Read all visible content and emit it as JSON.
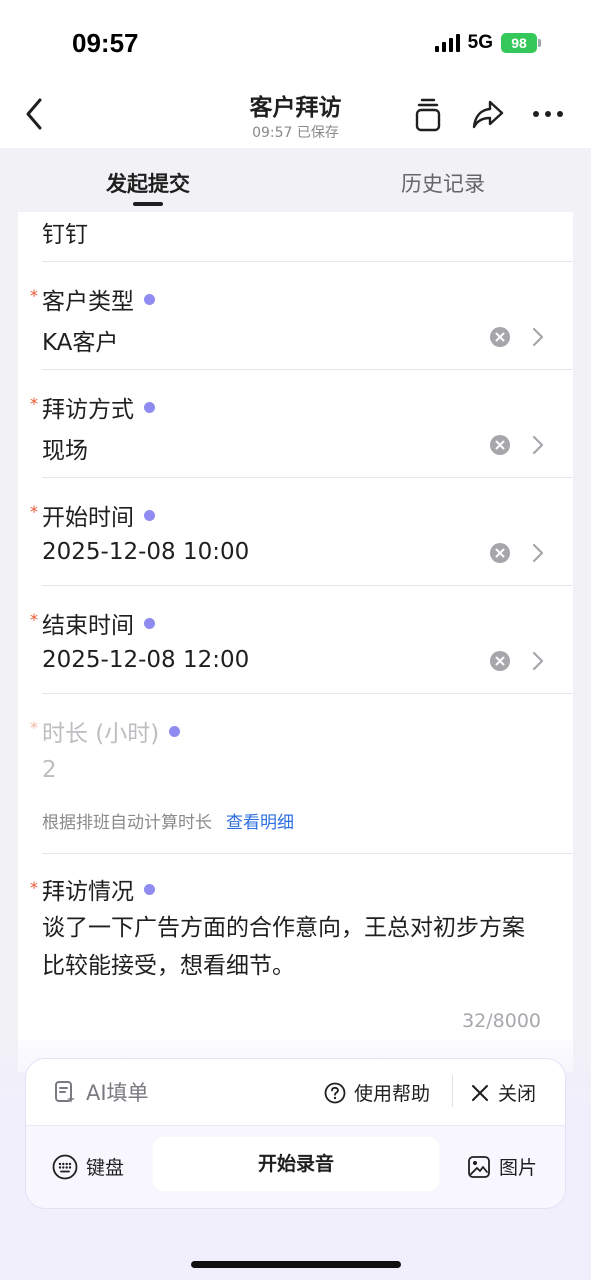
{
  "status": {
    "time": "09:57",
    "network": "5G",
    "battery": "98"
  },
  "nav": {
    "title": "客户拜访",
    "subtitle": "09:57 已保存",
    "icons": [
      "back-icon",
      "copy-icon",
      "share-icon",
      "more-icon"
    ]
  },
  "tabs": [
    {
      "label": "发起提交",
      "active": true
    },
    {
      "label": "历史记录",
      "active": false
    }
  ],
  "form": {
    "top_value": "钉钉",
    "customer_type": {
      "label": "客户类型",
      "value": "KA客户"
    },
    "visit_method": {
      "label": "拜访方式",
      "value": "现场"
    },
    "start_time": {
      "label": "开始时间",
      "value": "2025-12-08 10:00"
    },
    "end_time": {
      "label": "结束时间",
      "value": "2025-12-08 12:00"
    },
    "duration": {
      "label": "时长 (小时)",
      "value": "2",
      "hint": "根据排班自动计算时长",
      "hint_link": "查看明细"
    },
    "visit_notes": {
      "label": "拜访情况",
      "value": "谈了一下广告方面的合作意向，王总对初步方案比较能接受，想看细节。",
      "counter": "32/8000"
    },
    "required_mark": "*"
  },
  "ai_panel": {
    "title": "AI填单",
    "help": "使用帮助",
    "close": "关闭",
    "keyboard": "键盘",
    "record": "开始录音",
    "image": "图片"
  },
  "colors": {
    "accent_dot": "#8F8BF0",
    "required": "#E8552F",
    "link": "#2F6FE0",
    "battery": "#34C759"
  }
}
